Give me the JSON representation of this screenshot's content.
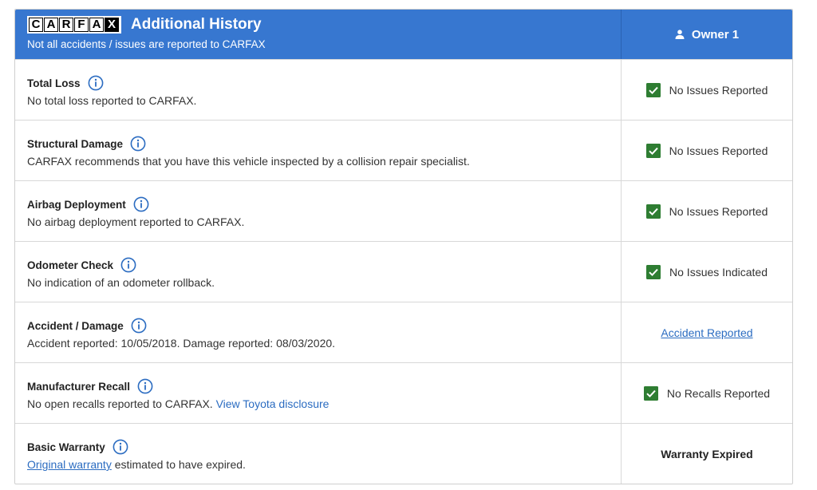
{
  "header": {
    "logo_letters": [
      "C",
      "A",
      "R",
      "F",
      "A",
      "X"
    ],
    "title": "Additional History",
    "subtitle": "Not all accidents / issues are reported to CARFAX",
    "owner_label": "Owner 1"
  },
  "rows": [
    {
      "title": "Total Loss",
      "description": "No total loss reported to CARFAX.",
      "status": "No Issues Reported"
    },
    {
      "title": "Structural Damage",
      "description": "CARFAX recommends that you have this vehicle inspected by a collision repair specialist.",
      "status": "No Issues Reported"
    },
    {
      "title": "Airbag Deployment",
      "description": "No airbag deployment reported to CARFAX.",
      "status": "No Issues Reported"
    },
    {
      "title": "Odometer Check",
      "description": "No indication of an odometer rollback.",
      "status": "No Issues Indicated"
    },
    {
      "title": "Accident / Damage",
      "description": "Accident reported: 10/05/2018. Damage reported: 08/03/2020.",
      "status": "Accident Reported"
    },
    {
      "title": "Manufacturer Recall",
      "description": "No open recalls reported to CARFAX.",
      "description_link": "View Toyota disclosure",
      "status": "No Recalls Reported"
    },
    {
      "title": "Basic Warranty",
      "description_link": "Original warranty",
      "description": "estimated to have expired.",
      "status": "Warranty Expired"
    }
  ],
  "colors": {
    "header_bg": "#3777d0",
    "check_green": "#2e7d32",
    "link_blue": "#2b6cc1"
  },
  "icons": {
    "info": "info-circle-icon",
    "check": "checkbox-checked-icon",
    "owner": "person-icon"
  }
}
